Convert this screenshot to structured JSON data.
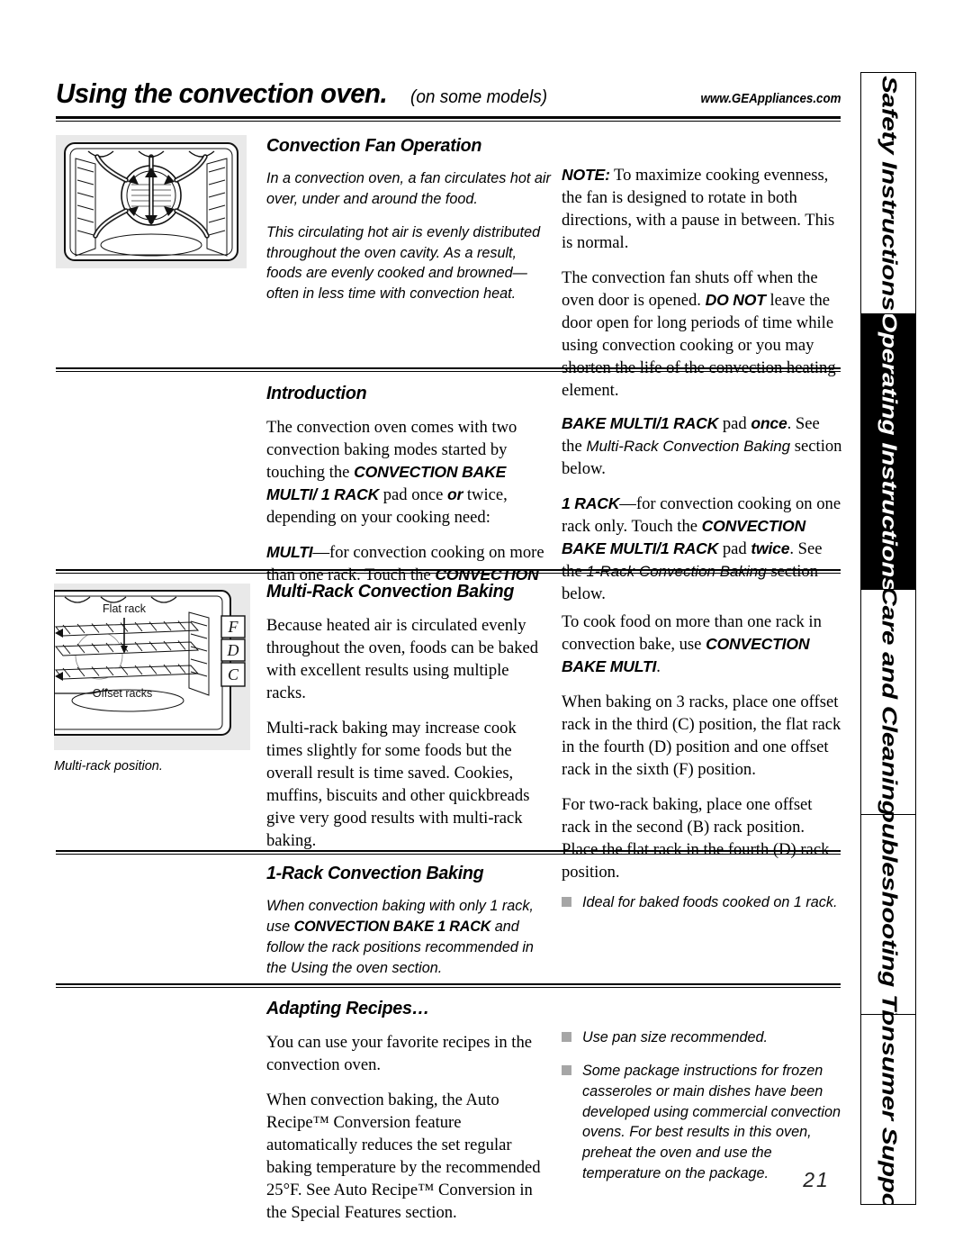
{
  "header": {
    "title": "Using the convection oven.",
    "subtitle": "(on some models)",
    "website": "www.GEAppliances.com"
  },
  "tabs": [
    {
      "label": "Safety Instructions",
      "active": false
    },
    {
      "label": "Operating Instructions",
      "active": true
    },
    {
      "label": "Care and Cleaning",
      "active": false
    },
    {
      "label": "Troubleshooting Tips",
      "active": false
    },
    {
      "label": "Consumer Support",
      "active": false
    }
  ],
  "figures": {
    "fan": {
      "name": "convection-oven-airflow-illustration",
      "caption": ""
    },
    "racks": {
      "name": "multi-rack-position-illustration",
      "caption": "Multi-rack position.",
      "label_flat_rack": "Flat rack",
      "label_offset_racks": "Offset racks",
      "rack_letters": [
        "F",
        "D",
        "C"
      ]
    }
  },
  "sections": {
    "fan_operation": {
      "heading": "Convection Fan Operation",
      "left": [
        "In a convection oven, a fan circulates hot air over, under and around the food.",
        "This circulating hot air is evenly distributed throughout the oven cavity. As a result, foods are evenly cooked and browned—often in less time with convection heat."
      ],
      "right_note_label": "NOTE:",
      "right_note_text": " To maximize cooking evenness, the fan is designed to rotate in both directions, with a pause in between. This is normal.",
      "right_p2_a": "The convection fan shuts off when the oven door is opened. ",
      "right_p2_b": "DO NOT",
      "right_p2_c": " leave the door open for long periods of time while using convection cooking or you may shorten the life of the convection heating element."
    },
    "introduction": {
      "heading": "Introduction",
      "left_p1_a": "The convection oven comes with two convection baking modes started by touching the ",
      "left_p1_b": "CONVECTION BAKE MULTI/ 1 RACK",
      "left_p1_c": " pad once ",
      "left_p1_d": "or",
      "left_p1_e": " twice, depending on your cooking need:",
      "left_p2_a": "MULTI",
      "left_p2_b": "—for convection cooking on more than one rack. Touch the ",
      "left_p2_c": "CONVECTION",
      "right_p1_a": "BAKE MULTI/1 RACK",
      "right_p1_b": " pad ",
      "right_p1_c": "once",
      "right_p1_d": ". See the ",
      "right_p1_e": "Multi-Rack Convection Baking",
      "right_p1_f": " section below.",
      "right_p2_a": "1 RACK",
      "right_p2_b": "—for convection cooking on one rack only. Touch the ",
      "right_p2_c": "CONVECTION BAKE MULTI/1 RACK",
      "right_p2_d": " pad ",
      "right_p2_e": "twice",
      "right_p2_f": ". See the ",
      "right_p2_g": "1-Rack Convection Baking",
      "right_p2_h": " section below."
    },
    "multi_rack": {
      "heading": "Multi-Rack Convection Baking",
      "left": [
        "Because heated air is circulated evenly throughout the oven, foods can be baked with excellent results using multiple racks.",
        "Multi-rack baking may increase cook times slightly for some foods but the overall result is time saved. Cookies, muffins, biscuits and other quickbreads give very good results with multi-rack baking."
      ],
      "right_p1_a": "To cook food on more than one rack in convection bake, use ",
      "right_p1_b": "CONVECTION BAKE MULTI",
      "right_p1_c": ".",
      "right_rest": [
        "When baking on 3 racks, place one offset rack in the third (C) position, the flat rack in the fourth (D) position and one offset rack in the sixth (F) position.",
        "For two-rack baking, place one offset rack in the second (B) rack position. Place the flat rack in the fourth (D) rack position."
      ]
    },
    "one_rack": {
      "heading": "1-Rack Convection Baking",
      "left_a": "When convection baking with only 1 rack, use ",
      "left_b": "CONVECTION BAKE 1 RACK",
      "left_c": " and follow the rack positions recommended in the Using the oven section.",
      "bullets": [
        "Ideal for baked foods cooked on 1 rack."
      ]
    },
    "adapting": {
      "heading": "Adapting Recipes…",
      "left": [
        "You can use your favorite recipes in the convection oven.",
        "When convection baking, the Auto Recipe™ Conversion feature automatically reduces the set regular baking temperature by the recommended 25°F. See Auto Recipe™ Conversion in the Special Features section."
      ],
      "bullets": [
        "Use pan size recommended.",
        "Some package instructions for frozen casseroles or main dishes have been developed using commercial convection ovens. For best results in this oven, preheat the oven and use the temperature on the package."
      ]
    }
  },
  "page_number": "21"
}
